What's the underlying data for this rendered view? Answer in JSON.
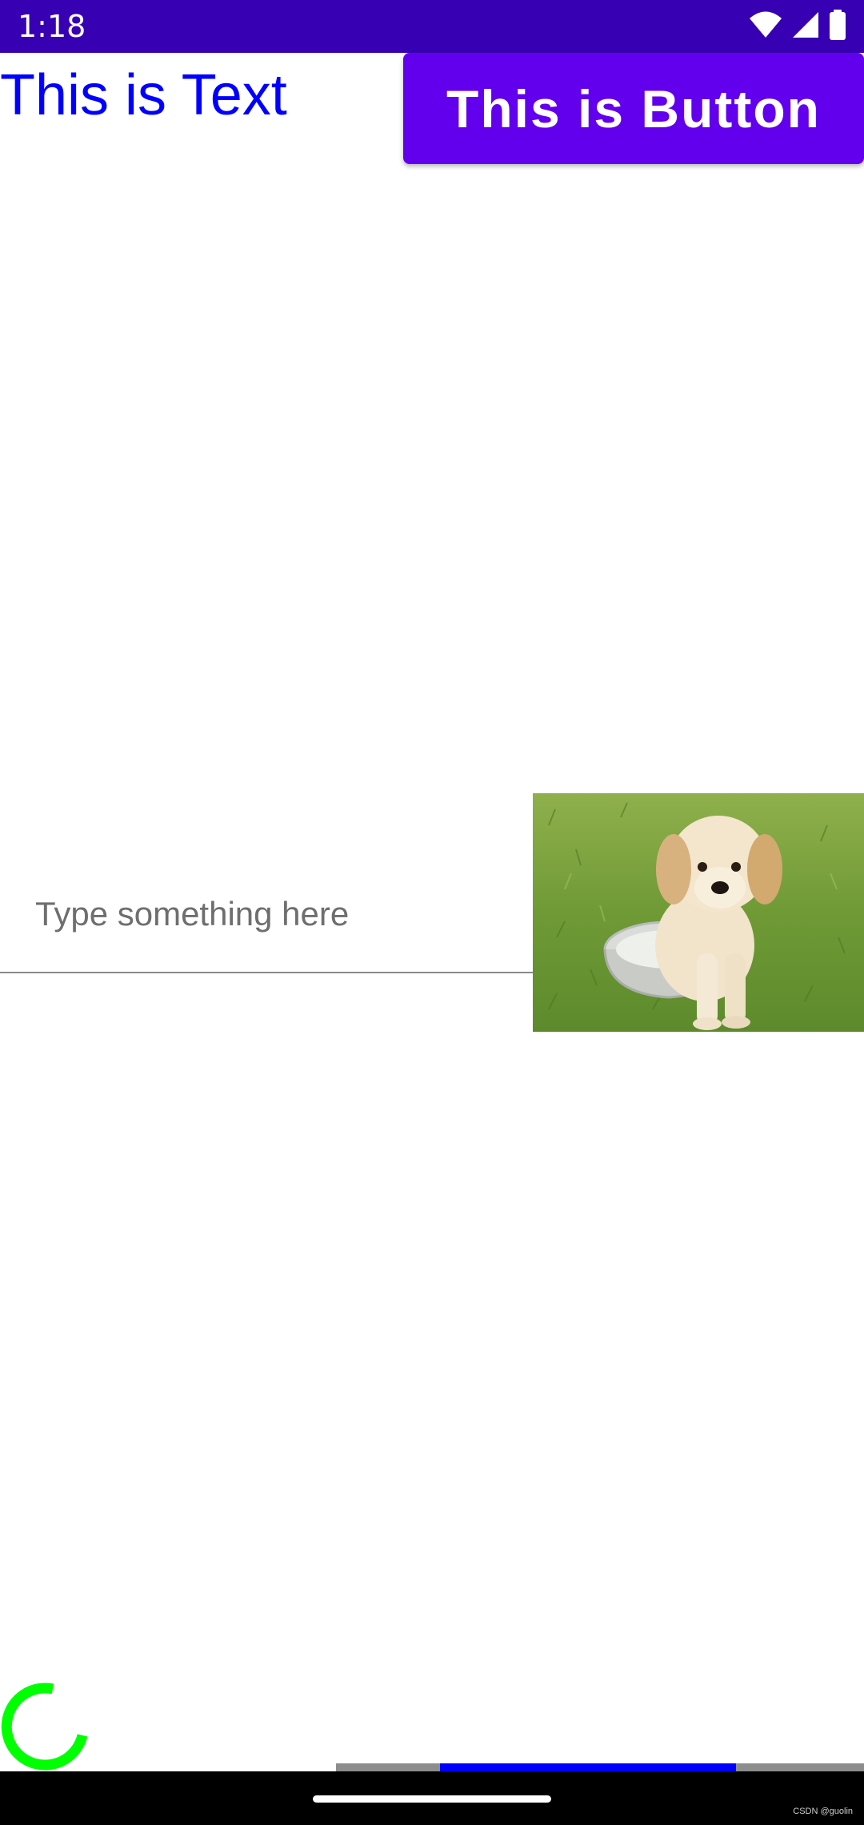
{
  "status_bar": {
    "time": "1:18",
    "icons": [
      "wifi-icon",
      "signal-icon",
      "battery-icon"
    ],
    "color": "#3700b3"
  },
  "content": {
    "text_view": "This is Text",
    "text_color": "#0000ff",
    "button_label": "This is Button",
    "button_color": "#6200ee",
    "edit_text_placeholder": "Type something here",
    "spinner_color": "#00ff00",
    "progress": {
      "track_color": "#8d8d8d",
      "fill_color": "#0000ff",
      "secondary_fraction": 0.56
    }
  },
  "nav_bar": {
    "watermark": "CSDN @guolin"
  }
}
